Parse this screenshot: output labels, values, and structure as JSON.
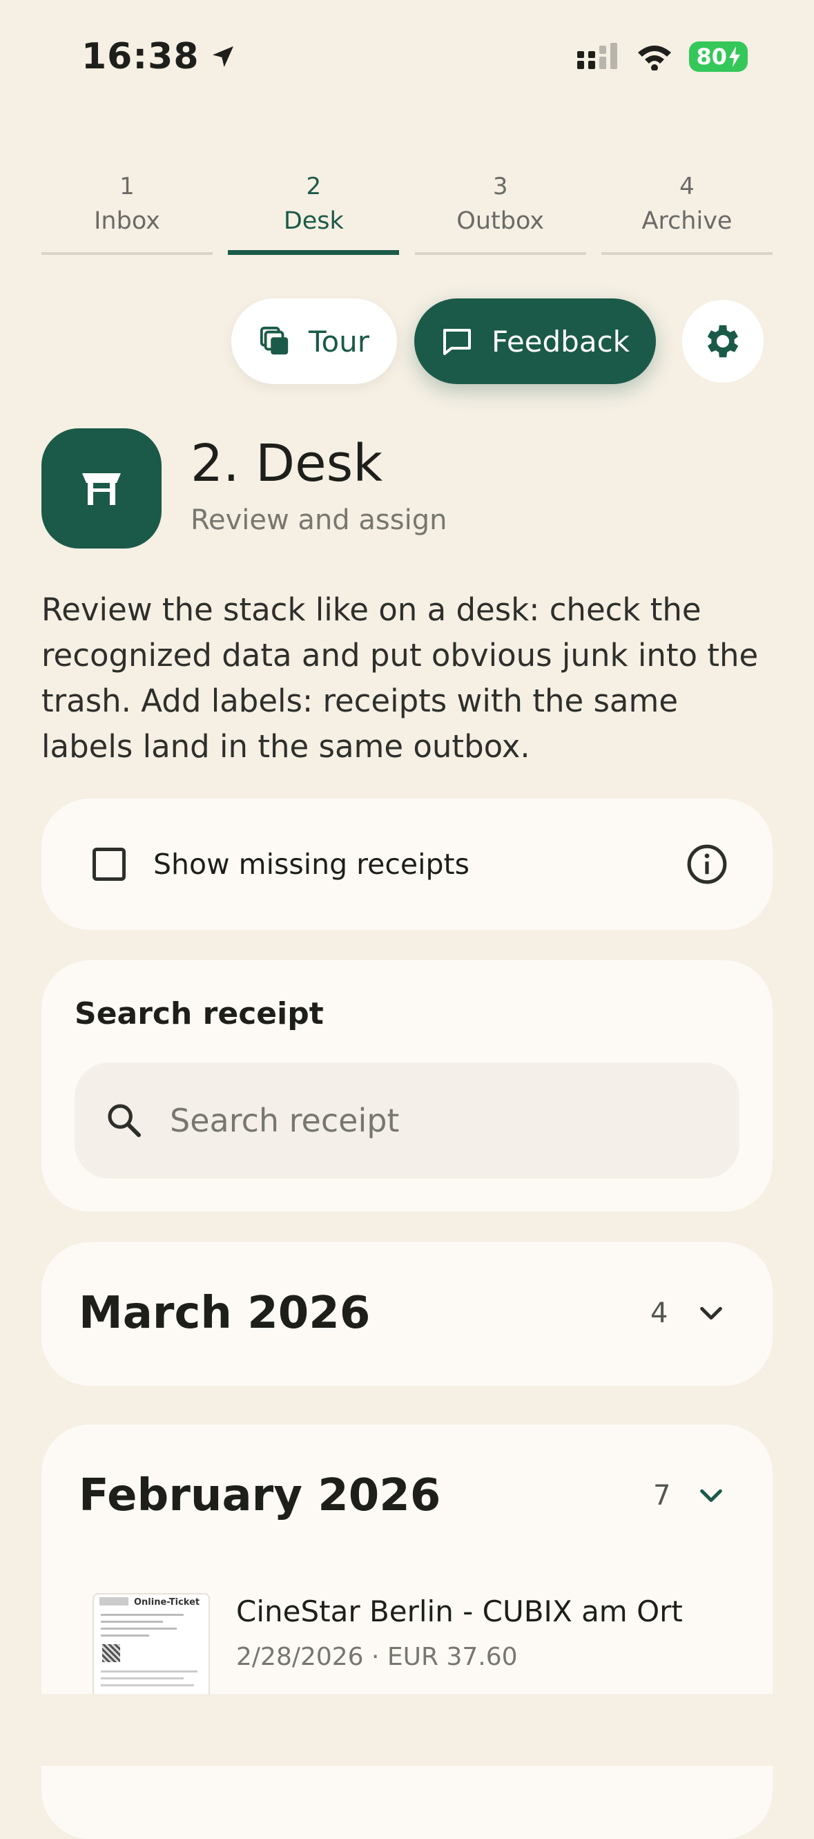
{
  "status_bar": {
    "time": "16:38",
    "battery": "80"
  },
  "tabs": [
    {
      "num": "1",
      "label": "Inbox"
    },
    {
      "num": "2",
      "label": "Desk"
    },
    {
      "num": "3",
      "label": "Outbox"
    },
    {
      "num": "4",
      "label": "Archive"
    }
  ],
  "actions": {
    "tour_label": "Tour",
    "feedback_label": "Feedback"
  },
  "header": {
    "title": "2. Desk",
    "subtitle": "Review and assign",
    "description": "Review the stack like on a desk: check the recognized data and put obvious junk into the trash. Add labels: receipts with the same labels land in the same outbox."
  },
  "missing": {
    "label": "Show missing receipts",
    "checked": false
  },
  "search": {
    "heading": "Search receipt",
    "placeholder": "Search receipt"
  },
  "groups": [
    {
      "month": "March 2026",
      "count": "4",
      "expanded": false
    },
    {
      "month": "February 2026",
      "count": "7",
      "expanded": true
    }
  ],
  "receipts": [
    {
      "title": "CineStar Berlin - CUBIX am Ort",
      "meta": "2/28/2026 · EUR 37.60",
      "thumb_header": "Online-Ticket"
    }
  ],
  "colors": {
    "accent": "#1B5A48",
    "background": "#F5EFE4",
    "card": "#FDFAF5"
  }
}
